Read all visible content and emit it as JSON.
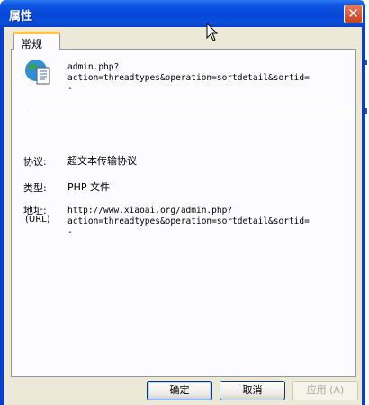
{
  "window": {
    "title": "属性"
  },
  "tabs": [
    {
      "label": "常规"
    }
  ],
  "file": {
    "name": "admin.php?\naction=threadtypes&operation=sortdetail&sortid=\n-"
  },
  "properties": {
    "protocol_label": "协议:",
    "protocol_value": "超文本传输协议",
    "type_label": "类型:",
    "type_value": "PHP 文件",
    "address_label": "地址:",
    "address_sublabel": "(URL)",
    "address_value": "http://www.xiaoai.org/admin.php?\naction=threadtypes&operation=sortdetail&sortid=\n-"
  },
  "buttons": {
    "ok": "确定",
    "cancel": "取消",
    "apply": "应用 (A)"
  },
  "icons": [
    "globe-document-icon",
    "close-icon",
    "mouse-cursor-icon"
  ],
  "colors": {
    "titlebar": "#0547d8",
    "dialog_bg": "#ece9d8",
    "tab_accent": "#ffc83c"
  }
}
